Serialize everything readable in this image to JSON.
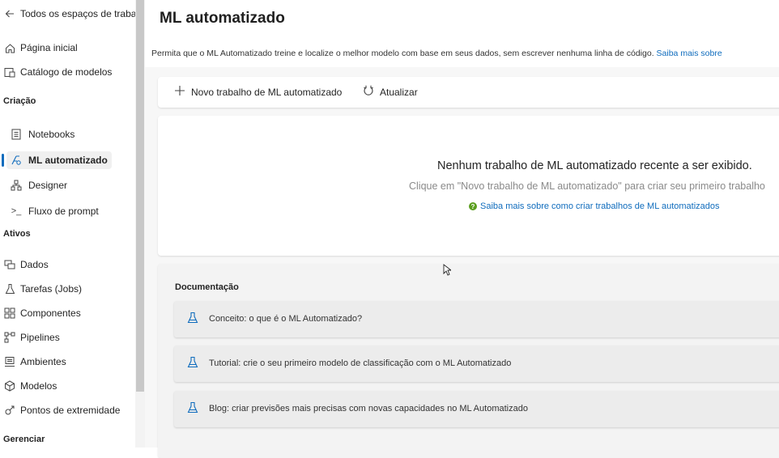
{
  "sidebar": {
    "back_label": "Todos os espaços de trabalho",
    "top_items": [
      {
        "label": "Página inicial",
        "icon": "home-icon"
      },
      {
        "label": "Catálogo de modelos",
        "icon": "catalog-icon"
      }
    ],
    "sections": {
      "criacao": "Criação",
      "ativos": "Ativos",
      "gerenciar": "Gerenciar"
    },
    "criacao_items": [
      {
        "label": "Notebooks",
        "icon": "notebook-icon"
      },
      {
        "label": "ML automatizado",
        "icon": "automl-icon",
        "selected": true
      },
      {
        "label": "Designer",
        "icon": "designer-icon"
      },
      {
        "label": "Fluxo de prompt",
        "icon": "prompt-flow-icon"
      }
    ],
    "ativos_items": [
      {
        "label": "Dados",
        "icon": "data-icon"
      },
      {
        "label": "Tarefas (Jobs)",
        "icon": "jobs-icon"
      },
      {
        "label": "Componentes",
        "icon": "components-icon"
      },
      {
        "label": "Pipelines",
        "icon": "pipelines-icon"
      },
      {
        "label": "Ambientes",
        "icon": "environments-icon"
      },
      {
        "label": "Modelos",
        "icon": "models-icon"
      },
      {
        "label": "Pontos de extremidade",
        "icon": "endpoints-icon"
      }
    ]
  },
  "main": {
    "title": "ML automatizado",
    "subtitle": "Permita que o ML Automatizado treine e localize o melhor modelo com base em seus dados, sem escrever nenhuma linha de código.",
    "subtitle_link": "Saiba mais sobre",
    "toolbar": {
      "new_label": "Novo trabalho de ML automatizado",
      "refresh_label": "Atualizar"
    },
    "empty": {
      "title": "Nenhum trabalho de ML automatizado recente a ser exibido.",
      "description": "Clique em \"Novo trabalho de ML automatizado\" para criar seu primeiro trabalho",
      "link": "Saiba mais sobre como criar trabalhos de ML automatizados"
    },
    "docs": {
      "title": "Documentação",
      "items": [
        "Conceito: o que é o ML Automatizado?",
        "Tutorial: crie o seu primeiro modelo de classificação com o ML Automatizado",
        "Blog: criar previsões mais precisas com novas capacidades no ML Automatizado"
      ]
    }
  },
  "colors": {
    "accent": "#0f6cbd",
    "help_green": "#5b9e1f"
  }
}
